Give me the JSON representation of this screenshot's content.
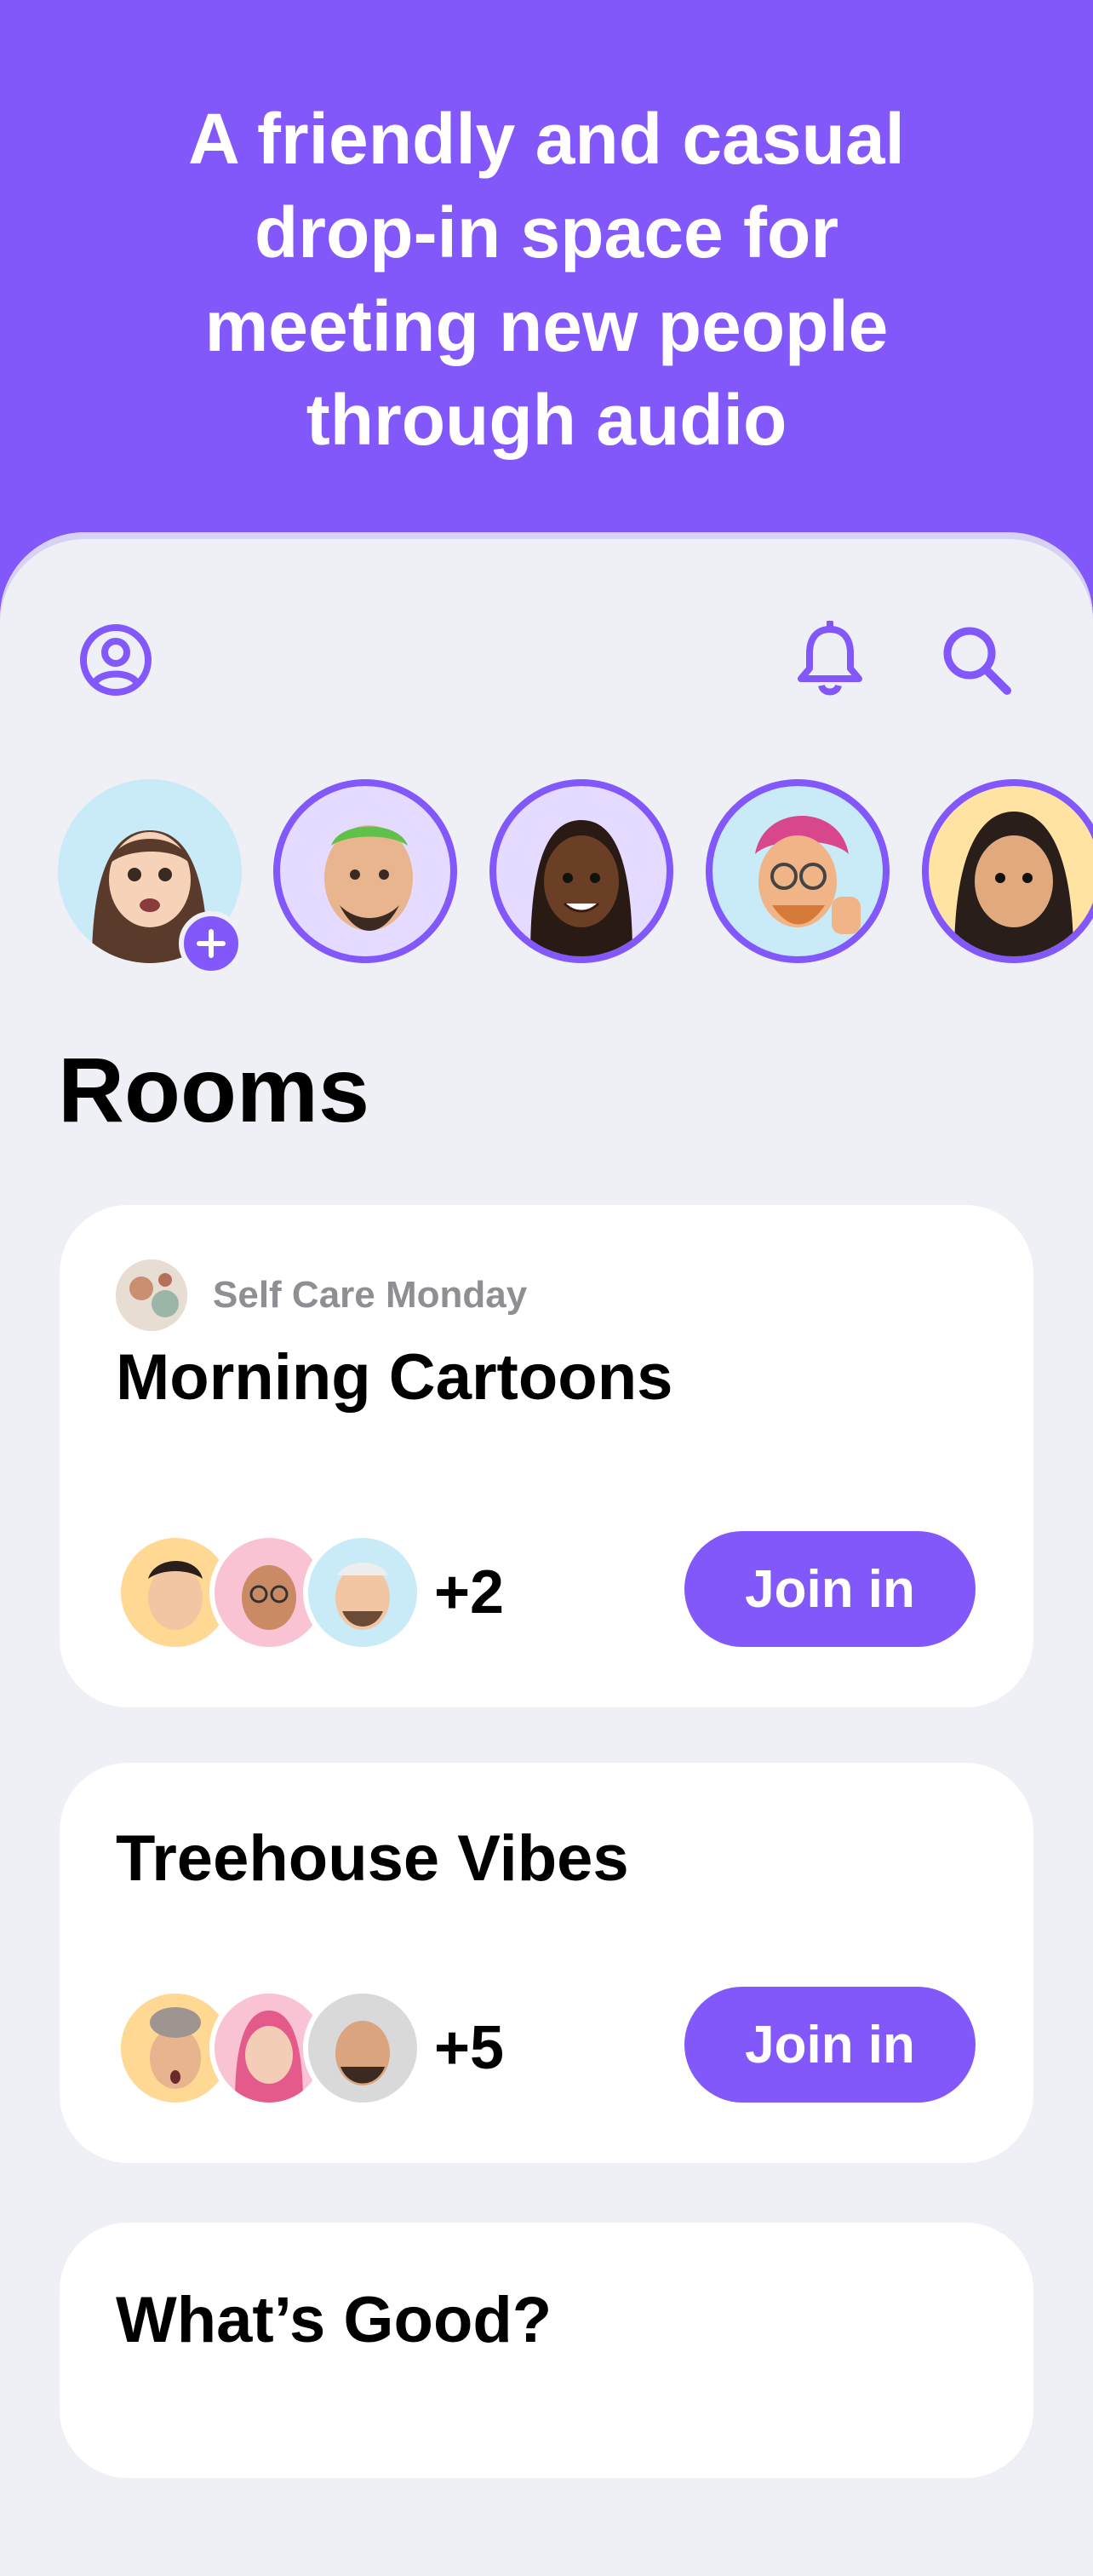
{
  "hero": {
    "line1": "A friendly and casual",
    "line2": "drop-in space for",
    "line3": "meeting new people",
    "line4": "through audio"
  },
  "toolbar": {
    "profile_icon": "profile-icon",
    "notifications_icon": "bell-icon",
    "search_icon": "search-icon"
  },
  "stories": [
    "self",
    "user-2",
    "user-3",
    "user-4",
    "user-5"
  ],
  "rooms": {
    "heading": "Rooms",
    "items": [
      {
        "club": "Self Care Monday",
        "title": "Morning Cartoons",
        "extra_count": "+2",
        "join_label": "Join in"
      },
      {
        "title": "Treehouse Vibes",
        "extra_count": "+5",
        "join_label": "Join in"
      },
      {
        "title": "What’s Good?"
      }
    ]
  },
  "colors": {
    "accent": "#8358FA",
    "background": "#EFEFF6",
    "card": "#FFFFFF"
  }
}
